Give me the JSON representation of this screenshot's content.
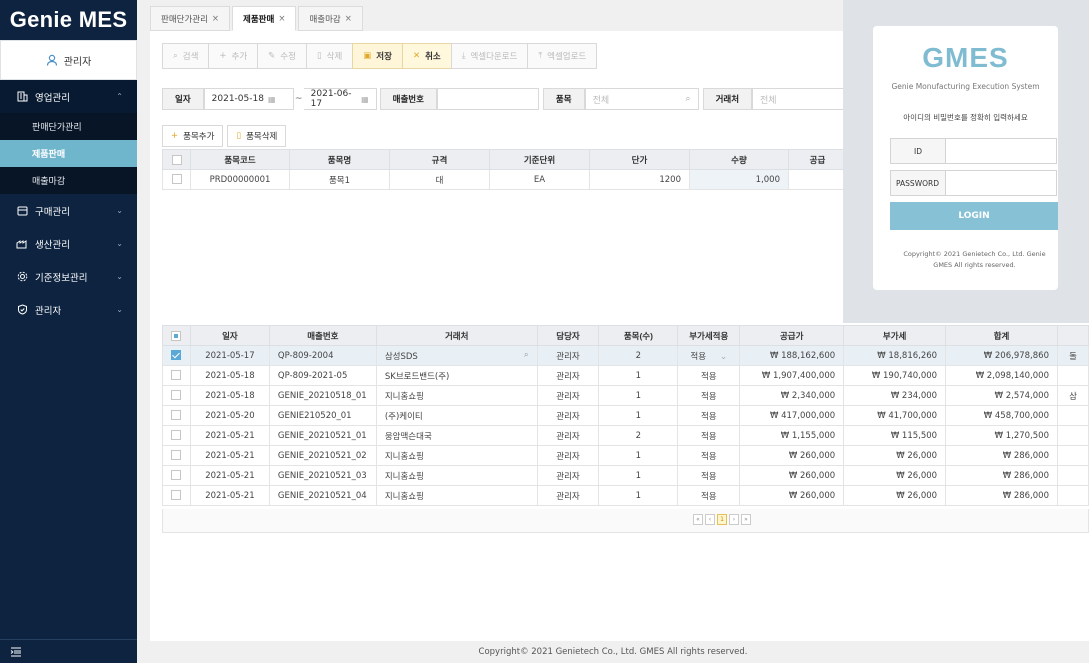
{
  "app": {
    "logo": "Genie MES"
  },
  "user": {
    "name": "관리자"
  },
  "sidebar": {
    "items": [
      {
        "label": "영업관리",
        "open": true,
        "children": [
          "판매단가관리",
          "제품판매",
          "매출마감"
        ]
      },
      {
        "label": "구매관리"
      },
      {
        "label": "생산관리"
      },
      {
        "label": "기준정보관리"
      },
      {
        "label": "관리자"
      }
    ]
  },
  "tabs": [
    {
      "label": "판매단가관리",
      "close": "×"
    },
    {
      "label": "제품판매",
      "close": "×"
    },
    {
      "label": "매출마감",
      "close": "×"
    }
  ],
  "toolbar": {
    "search": "검색",
    "add": "추가",
    "edit": "수정",
    "delete": "삭제",
    "save": "저장",
    "cancel": "취소",
    "excel_down": "엑셀다운로드",
    "excel_up": "엑셀업로드"
  },
  "filter": {
    "date_label": "일자",
    "date_from": "2021-05-18",
    "tilde": "~",
    "date_to": "2021-06-17",
    "sales_no_label": "매출번호",
    "item_label": "품목",
    "item_placeholder": "전체",
    "partner_label": "거래처",
    "partner_placeholder": "전체"
  },
  "item_buttons": {
    "add": "품목추가",
    "delete": "품목삭제"
  },
  "items_table": {
    "headers": [
      "품목코드",
      "품목명",
      "규격",
      "기준단위",
      "단가",
      "수량",
      "공급"
    ],
    "rows": [
      {
        "code": "PRD00000001",
        "name": "품목1",
        "spec": "대",
        "unit": "EA",
        "price": "1200",
        "qty": "1,000"
      }
    ]
  },
  "sales_table": {
    "headers": [
      "일자",
      "매출번호",
      "거래처",
      "담당자",
      "품목(수)",
      "부가세적용",
      "공급가",
      "부가세",
      "합계"
    ],
    "rows": [
      {
        "date": "2021-05-17",
        "no": "QP-809-2004",
        "partner": "삼성SDS",
        "manager": "관리자",
        "count": "2",
        "vat": "적용",
        "supply": "₩ 188,162,600",
        "tax": "₩ 18,816,260",
        "total": "₩ 206,978,860",
        "extra": "돌"
      },
      {
        "date": "2021-05-18",
        "no": "QP-809-2021-05",
        "partner": "SK브로드밴드(주)",
        "manager": "관리자",
        "count": "1",
        "vat": "적용",
        "supply": "₩ 1,907,400,000",
        "tax": "₩ 190,740,000",
        "total": "₩ 2,098,140,000",
        "extra": ""
      },
      {
        "date": "2021-05-18",
        "no": "GENIE_20210518_01",
        "partner": "지니홈쇼핑",
        "manager": "관리자",
        "count": "1",
        "vat": "적용",
        "supply": "₩ 2,340,000",
        "tax": "₩ 234,000",
        "total": "₩ 2,574,000",
        "extra": "삼"
      },
      {
        "date": "2021-05-20",
        "no": "GENIE210520_01",
        "partner": "(주)케이티",
        "manager": "관리자",
        "count": "1",
        "vat": "적용",
        "supply": "₩ 417,000,000",
        "tax": "₩ 41,700,000",
        "total": "₩ 458,700,000",
        "extra": ""
      },
      {
        "date": "2021-05-21",
        "no": "GENIE_20210521_01",
        "partner": "웅암맥슨대국",
        "manager": "관리자",
        "count": "2",
        "vat": "적용",
        "supply": "₩ 1,155,000",
        "tax": "₩ 115,500",
        "total": "₩ 1,270,500",
        "extra": ""
      },
      {
        "date": "2021-05-21",
        "no": "GENIE_20210521_02",
        "partner": "지니홈쇼핑",
        "manager": "관리자",
        "count": "1",
        "vat": "적용",
        "supply": "₩ 260,000",
        "tax": "₩ 26,000",
        "total": "₩ 286,000",
        "extra": ""
      },
      {
        "date": "2021-05-21",
        "no": "GENIE_20210521_03",
        "partner": "지니홈쇼핑",
        "manager": "관리자",
        "count": "1",
        "vat": "적용",
        "supply": "₩ 260,000",
        "tax": "₩ 26,000",
        "total": "₩ 286,000",
        "extra": ""
      },
      {
        "date": "2021-05-21",
        "no": "GENIE_20210521_04",
        "partner": "지니홈쇼핑",
        "manager": "관리자",
        "count": "1",
        "vat": "적용",
        "supply": "₩ 260,000",
        "tax": "₩ 26,000",
        "total": "₩ 286,000",
        "extra": ""
      }
    ]
  },
  "pager": {
    "first": "«",
    "prev": "‹",
    "page": "1",
    "next": "›",
    "last": "»"
  },
  "login": {
    "title": "GMES",
    "subtitle": "Genie Monufacturing Execution System",
    "message": "아이디의 비밀번호를 정확히 입력하세요",
    "id_label": "ID",
    "pw_label": "PASSWORD",
    "button": "LOGIN",
    "copyright": "Copyright© 2021 Genietech Co., Ltd. Genie GMES All rights reserved."
  },
  "footer": {
    "text": "Copyright© 2021 Genietech Co., Ltd. GMES All rights reserved."
  },
  "colors": {
    "sidebar": "#0d2340",
    "active_menu": "#6fb5cc",
    "accent": "#86c1d6",
    "highlight": "#e1a92a"
  }
}
